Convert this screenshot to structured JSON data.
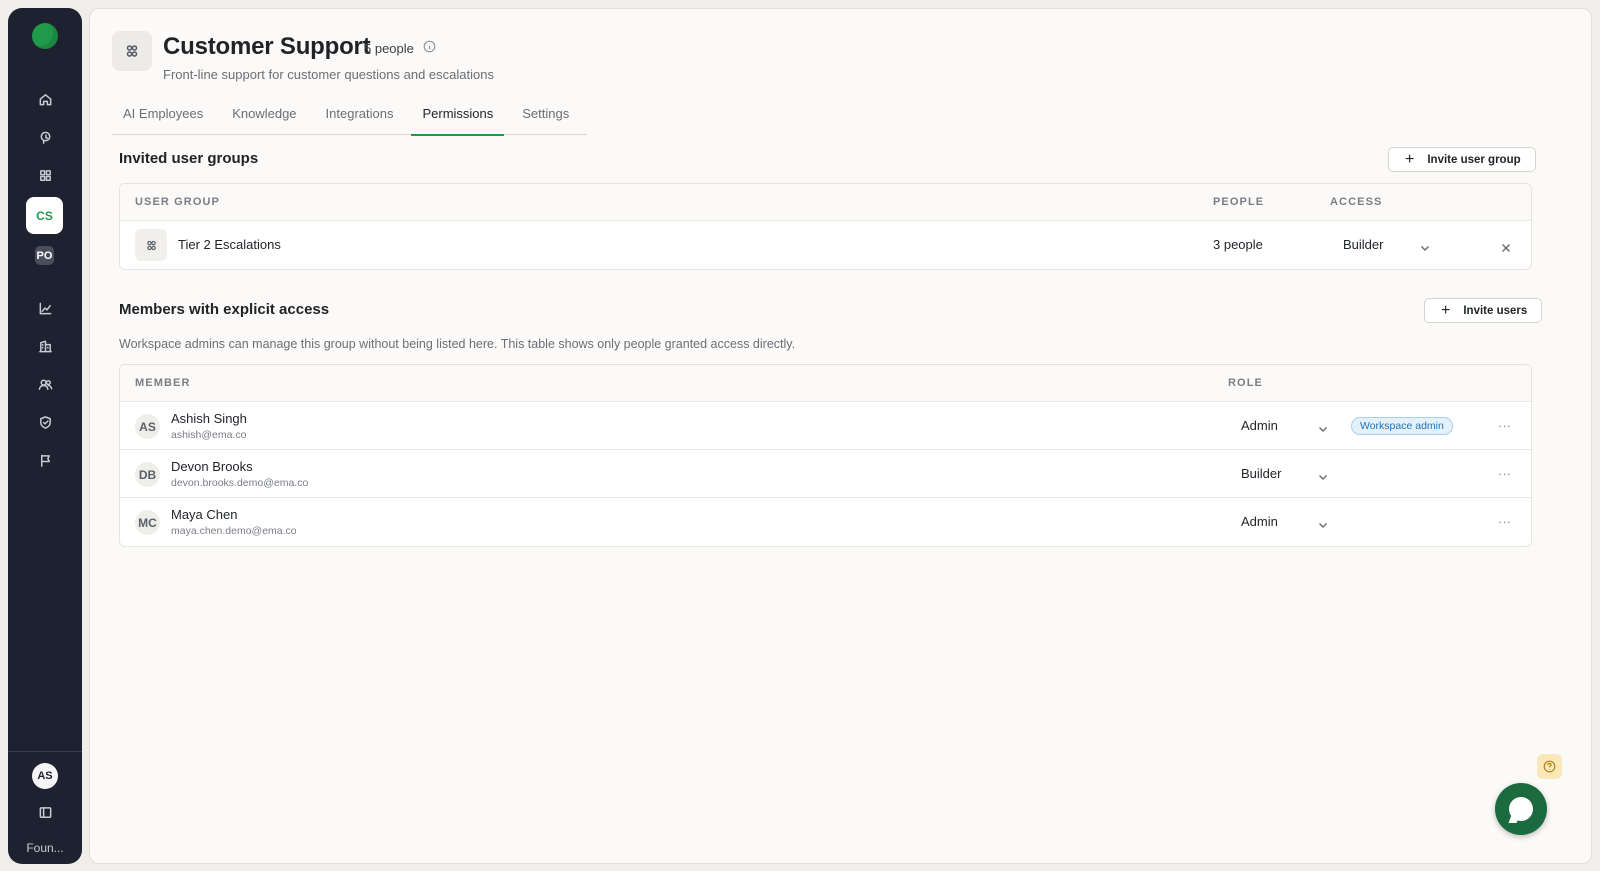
{
  "sidebar": {
    "workspaces": [
      {
        "abbr": "CS",
        "active": true
      },
      {
        "abbr": "PO",
        "active": false
      }
    ],
    "user_initials": "AS",
    "footer_label": "Foun..."
  },
  "header": {
    "title": "Customer Support",
    "people_count": "5 people",
    "subtitle": "Front-line support for customer questions and escalations"
  },
  "tabs": [
    {
      "label": "AI Employees"
    },
    {
      "label": "Knowledge"
    },
    {
      "label": "Integrations"
    },
    {
      "label": "Permissions",
      "active": true
    },
    {
      "label": "Settings"
    }
  ],
  "groups_section": {
    "title": "Invited user groups",
    "invite_label": "Invite user group",
    "columns": {
      "group": "USER GROUP",
      "people": "PEOPLE",
      "access": "ACCESS"
    },
    "rows": [
      {
        "name": "Tier 2 Escalations",
        "people": "3 people",
        "access": "Builder"
      }
    ]
  },
  "members_section": {
    "title": "Members with explicit access",
    "invite_label": "Invite users",
    "note": "Workspace admins can manage this group without being listed here. This table shows only people granted access directly.",
    "columns": {
      "member": "MEMBER",
      "role": "ROLE"
    },
    "rows": [
      {
        "initials": "AS",
        "name": "Ashish Singh",
        "email": "ashish@ema.co",
        "role": "Admin",
        "badge": "Workspace admin"
      },
      {
        "initials": "DB",
        "name": "Devon Brooks",
        "email": "devon.brooks.demo@ema.co",
        "role": "Builder",
        "badge": ""
      },
      {
        "initials": "MC",
        "name": "Maya Chen",
        "email": "maya.chen.demo@ema.co",
        "role": "Admin",
        "badge": ""
      }
    ]
  },
  "colors": {
    "accent": "#1f9a4a",
    "sidebar_bg": "#1e2130",
    "badge_blue": "#1f73b7"
  }
}
